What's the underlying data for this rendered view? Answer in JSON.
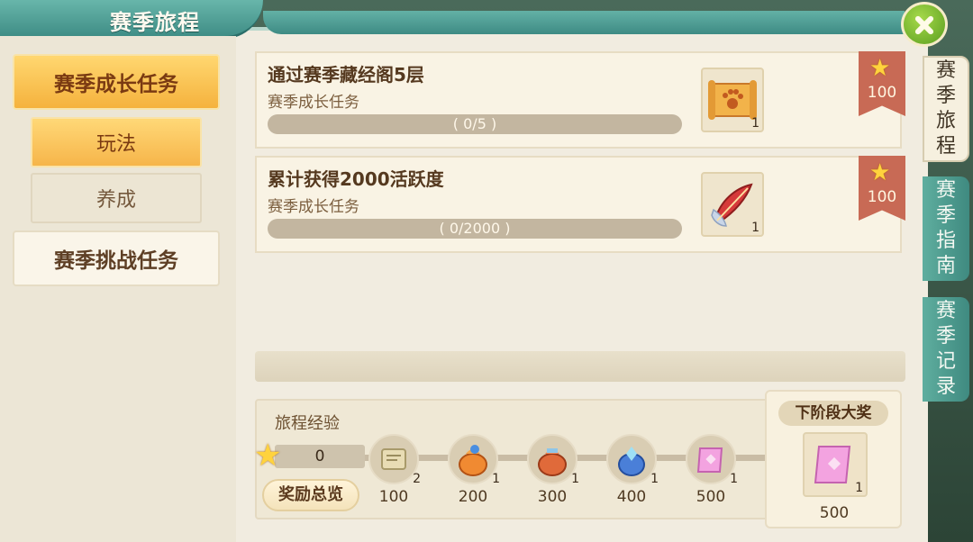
{
  "window": {
    "title": "赛季旅程"
  },
  "left_nav": {
    "main_category": "赛季成长任务",
    "sub_items": [
      "玩法",
      "养成"
    ],
    "challenge_category": "赛季挑战任务"
  },
  "tasks": [
    {
      "title": "通过赛季藏经阁5层",
      "subtitle": "赛季成长任务",
      "progress_text": "( 0/5 )",
      "progress": 0,
      "reward_icon": "paw-scroll-icon",
      "reward_count": "1",
      "points": "100"
    },
    {
      "title": "累计获得2000活跃度",
      "subtitle": "赛季成长任务",
      "progress_text": "( 0/2000 )",
      "progress": 0,
      "reward_icon": "red-feather-icon",
      "reward_count": "1",
      "points": "100"
    }
  ],
  "journey": {
    "exp_label": "旅程经验",
    "exp_value": "0",
    "overview_button": "奖励总览",
    "milestones": [
      {
        "threshold": "100",
        "count": "2",
        "icon": "scroll-icon"
      },
      {
        "threshold": "200",
        "count": "1",
        "icon": "orange-bag-icon"
      },
      {
        "threshold": "300",
        "count": "1",
        "icon": "coin-bag-icon"
      },
      {
        "threshold": "400",
        "count": "1",
        "icon": "crystal-bag-icon"
      },
      {
        "threshold": "500",
        "count": "1",
        "icon": "pink-scroll-icon"
      }
    ],
    "next_prize": {
      "title": "下阶段大奖",
      "count": "1",
      "value": "500",
      "icon": "pink-scroll-icon"
    }
  },
  "side_tabs": [
    {
      "label": "赛季旅程",
      "active": true
    },
    {
      "label": "赛季指南",
      "active": false
    },
    {
      "label": "赛季记录",
      "active": false
    }
  ],
  "colors": {
    "accent_orange": "#f5b23d",
    "teal": "#3f8e86",
    "ribbon_red": "#c86a55"
  }
}
